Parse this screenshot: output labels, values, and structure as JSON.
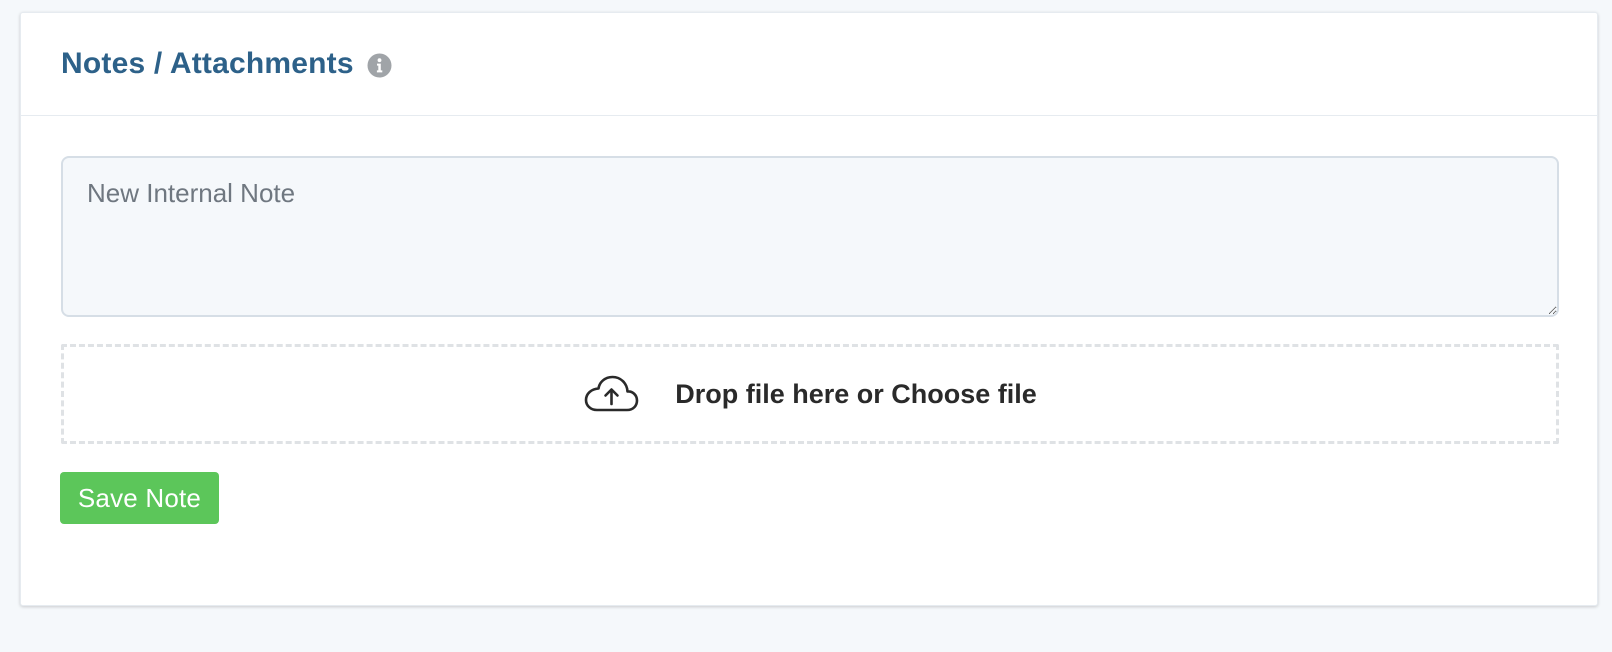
{
  "panel": {
    "title": "Notes / Attachments",
    "info_icon": "info-circle-icon"
  },
  "note": {
    "value": "",
    "placeholder": "New Internal Note"
  },
  "dropzone": {
    "icon": "cloud-upload-icon",
    "label": "Drop file here or Choose file"
  },
  "actions": {
    "save_label": "Save Note"
  },
  "colors": {
    "title": "#2d6189",
    "save_button": "#5cc65a",
    "page_background": "#f5f8fb",
    "info_icon": "#a0a4a8"
  }
}
